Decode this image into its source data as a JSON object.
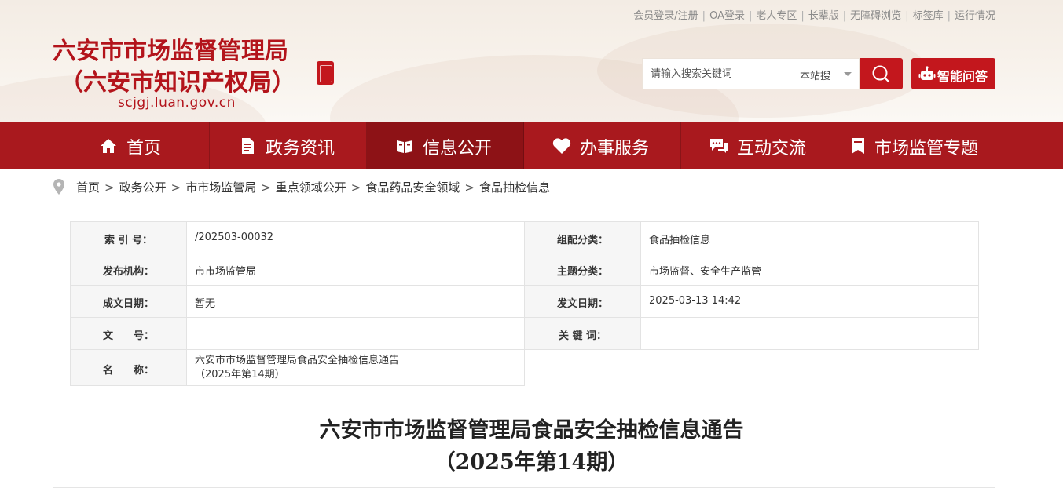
{
  "top_links": [
    "会员登录/注册",
    "OA登录",
    "老人专区",
    "长辈版",
    "无障碍浏览",
    "标签库",
    "运行情况"
  ],
  "logo": {
    "title_line1": "六安市市场监督管理局",
    "title_line2": "（六安市知识产权局）",
    "url": "scjgj.luan.gov.cn"
  },
  "search": {
    "placeholder": "请输入搜索关键词",
    "scope": "本站搜"
  },
  "ai_button": "智能问答",
  "nav": [
    {
      "label": "首页",
      "icon": "home-icon"
    },
    {
      "label": "政务资讯",
      "icon": "document-icon"
    },
    {
      "label": "信息公开",
      "icon": "open-book-icon",
      "active": true
    },
    {
      "label": "办事服务",
      "icon": "heart-icon"
    },
    {
      "label": "互动交流",
      "icon": "chat-icon"
    },
    {
      "label": "市场监管专题",
      "icon": "bookmark-icon"
    }
  ],
  "breadcrumb": [
    "首页",
    "政务公开",
    "市市场监管局",
    "重点领域公开",
    "食品药品安全领域",
    "食品抽检信息"
  ],
  "info_table": {
    "index_label": "索 引 号：",
    "index_value": "/202503-00032",
    "category_label": "组配分类：",
    "category_value": "食品抽检信息",
    "publisher_label": "发布机构：",
    "publisher_value": "市市场监管局",
    "topic_label": "主题分类：",
    "topic_value": "市场监督、安全生产监管",
    "created_label": "成文日期：",
    "created_value": "暂无",
    "published_label": "发文日期：",
    "published_value": "2025-03-13 14:42",
    "docno_label": "文　　号：",
    "docno_value": "",
    "keywords_label": "关 键 词：",
    "keywords_value": "",
    "name_label": "名　　称：",
    "name_value_line1": "六安市市场监督管理局食品安全抽检信息通告",
    "name_value_line2": "（2025年第14期）"
  },
  "article": {
    "title_line1": "六安市市场监督管理局食品安全抽检信息通告",
    "title_line2": "（2025年第14期）"
  },
  "colors": {
    "brand_red": "#b3141b",
    "nav_bg": "#a9191e",
    "nav_active": "#8d1216"
  }
}
